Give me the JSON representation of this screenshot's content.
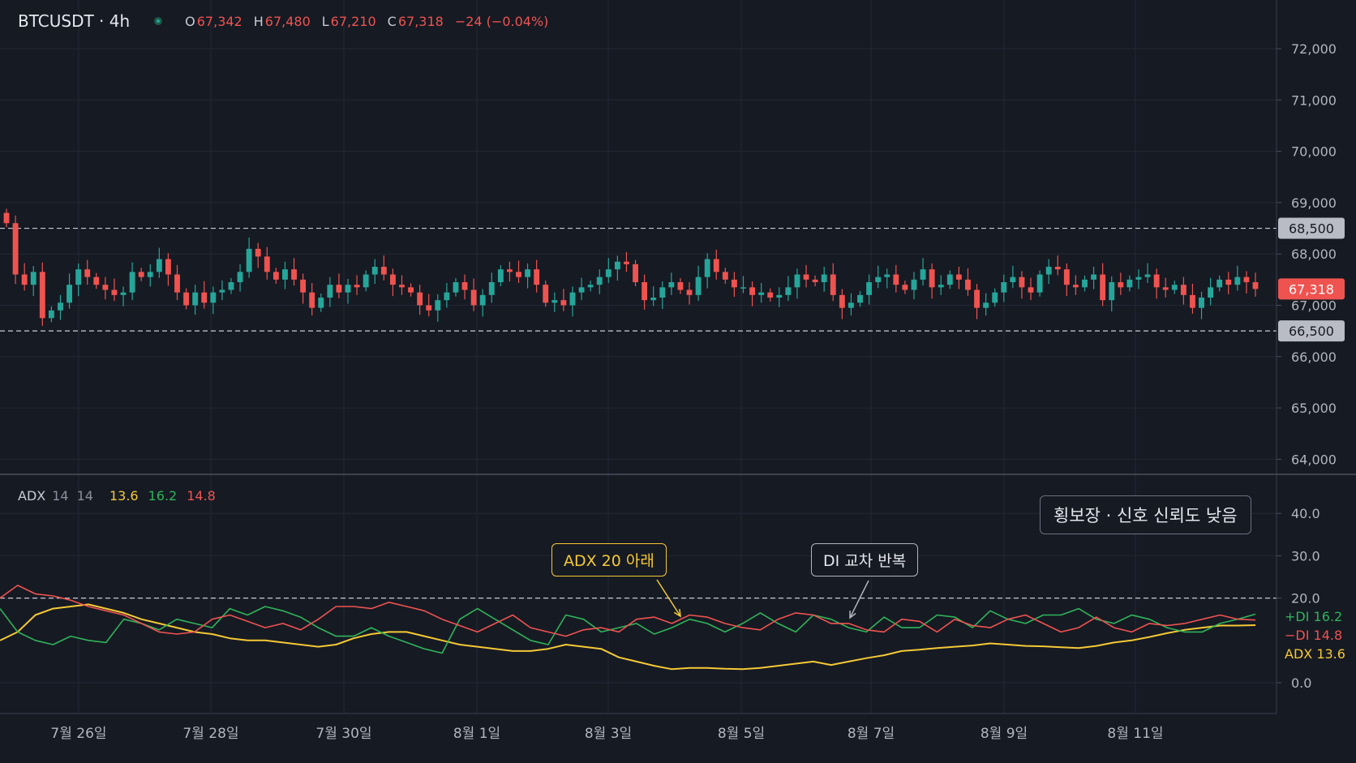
{
  "header": {
    "symbol": "BTCUSDT · 4h",
    "open_key": "O",
    "open": "67,342",
    "high_key": "H",
    "high": "67,480",
    "low_key": "L",
    "low": "67,210",
    "close_key": "C",
    "close": "67,318",
    "change": "−24 (−0.04%)"
  },
  "indicator": {
    "name": "ADX",
    "param1": "14",
    "param2": "14",
    "adx": "13.6",
    "plus_di": "16.2",
    "minus_di": "14.8"
  },
  "annotations": {
    "adx_note": "ADX 20 아래",
    "di_note": "DI 교차 반복",
    "regime_note": "횡보장 · 신호 신뢰도 낮음"
  },
  "price_axis": {
    "ticks": [
      "72,000",
      "71,000",
      "70,000",
      "69,000",
      "68,000",
      "67,000",
      "66,000",
      "65,000",
      "64,000"
    ],
    "resistance_label": "68,500",
    "support_label": "66,500",
    "last_label": "67,318"
  },
  "indicator_axis": {
    "ticks": [
      "40.0",
      "30.0",
      "20.0",
      "0.0"
    ],
    "plus_di_label": "+DI 16.2",
    "minus_di_label": "−DI 14.8",
    "adx_label": "ADX 13.6"
  },
  "time_axis": {
    "ticks": [
      "7월 26일",
      "7월 28일",
      "7월 30일",
      "8월 1일",
      "8월 3일",
      "8월 5일",
      "8월 7일",
      "8월 9일",
      "8월 11일"
    ]
  },
  "colors": {
    "background": "#161a23",
    "up": "#26a69a",
    "down": "#ef5350",
    "adx": "#f5c935",
    "plus_di": "#2fb45a",
    "minus_di": "#ef5350",
    "grid": "#232835",
    "label_gray": "#b2b5be"
  },
  "chart_data": [
    {
      "type": "candlestick",
      "title": "BTCUSDT · 4h",
      "timeframe": "4h",
      "x_ticks": [
        "7월 26일",
        "7월 28일",
        "7월 30일",
        "8월 1일",
        "8월 3일",
        "8월 5일",
        "8월 7일",
        "8월 9일",
        "8월 11일"
      ],
      "ylim": [
        63800,
        72600
      ],
      "y_ticks": [
        72000,
        71000,
        70000,
        69000,
        68000,
        67000,
        66000,
        65000,
        64000
      ],
      "last": {
        "open": 67342,
        "high": 67480,
        "low": 67210,
        "close": 67318,
        "change": -24,
        "change_pct": -0.04
      },
      "horizontal_levels": [
        {
          "value": 68500,
          "style": "dashed"
        },
        {
          "value": 66500,
          "style": "dashed"
        }
      ],
      "closes": [
        68600,
        67600,
        67400,
        67650,
        66750,
        66900,
        67050,
        67400,
        67700,
        67550,
        67400,
        67300,
        67200,
        67250,
        67650,
        67550,
        67650,
        67900,
        67600,
        67250,
        67000,
        67250,
        67050,
        67250,
        67300,
        67450,
        67650,
        68100,
        67950,
        67650,
        67500,
        67700,
        67500,
        67250,
        66950,
        67150,
        67400,
        67250,
        67400,
        67350,
        67600,
        67750,
        67600,
        67400,
        67350,
        67250,
        67000,
        66900,
        67100,
        67250,
        67450,
        67300,
        67000,
        67200,
        67450,
        67700,
        67650,
        67550,
        67700,
        67400,
        67050,
        67100,
        67000,
        67250,
        67350,
        67400,
        67550,
        67700,
        67850,
        67800,
        67450,
        67100,
        67150,
        67350,
        67450,
        67300,
        67200,
        67550,
        67900,
        67650,
        67500,
        67350,
        67350,
        67200,
        67250,
        67150,
        67200,
        67350,
        67600,
        67500,
        67450,
        67600,
        67200,
        66950,
        67050,
        67200,
        67450,
        67550,
        67600,
        67400,
        67300,
        67500,
        67700,
        67350,
        67400,
        67600,
        67500,
        67300,
        66950,
        67050,
        67250,
        67450,
        67550,
        67350,
        67250,
        67600,
        67750,
        67700,
        67400,
        67350,
        67500,
        67600,
        67100,
        67450,
        67350,
        67500,
        67550,
        67600,
        67350,
        67300,
        67400,
        67200,
        66950,
        67150,
        67350,
        67500,
        67400,
        67550,
        67450,
        67318
      ],
      "series": [
        {
          "name": "BTCUSDT"
        }
      ]
    },
    {
      "type": "line",
      "title": "ADX 14 14",
      "ylim": [
        -7,
        48
      ],
      "y_ticks": [
        40.0,
        30.0,
        20.0,
        0.0
      ],
      "reference_line": 20,
      "series": [
        {
          "name": "ADX",
          "color": "#f5c935",
          "values": [
            10,
            12,
            16,
            17.5,
            18,
            18.5,
            17.5,
            16.5,
            15,
            14,
            13,
            12,
            11.5,
            10.5,
            10,
            10,
            9.5,
            9,
            8.5,
            9,
            10.5,
            11.5,
            12,
            12,
            11,
            10,
            9,
            8.5,
            8,
            7.5,
            7.5,
            8,
            9,
            8.5,
            8,
            6,
            5,
            4,
            3.2,
            3.5,
            3.5,
            3.3,
            3.2,
            3.5,
            4,
            4.5,
            5,
            4.2,
            5,
            5.8,
            6.5,
            7.5,
            7.8,
            8.2,
            8.5,
            8.8,
            9.3,
            9,
            8.7,
            8.6,
            8.4,
            8.2,
            8.7,
            9.5,
            10,
            10.8,
            11.7,
            12.5,
            13,
            13.5,
            13.5,
            13.6
          ]
        },
        {
          "name": "+DI",
          "color": "#2fb45a",
          "values": [
            17.5,
            12,
            10,
            9,
            11,
            10,
            9.5,
            15,
            14,
            12.5,
            15,
            14,
            13,
            17.5,
            16,
            18,
            17,
            15.5,
            13,
            11,
            11,
            13,
            11,
            9.5,
            8,
            7,
            15,
            17.5,
            15,
            12.5,
            10,
            9,
            16,
            15,
            12,
            13,
            14,
            11.5,
            13,
            15,
            14,
            12,
            14,
            16.5,
            14,
            12,
            16,
            15,
            13,
            12,
            15.5,
            13,
            13,
            16,
            15.5,
            13,
            17,
            15,
            14,
            16,
            16,
            17.5,
            15,
            14,
            16,
            15,
            13,
            12,
            12,
            14,
            15,
            16.2
          ]
        },
        {
          "name": "−DI",
          "color": "#ef5350",
          "values": [
            20,
            23,
            21,
            20.5,
            19.5,
            18,
            17,
            16,
            14,
            12,
            11.5,
            12,
            15,
            16,
            14.5,
            13,
            14,
            12.5,
            15,
            18,
            18,
            17.5,
            19,
            18,
            17,
            15,
            13.5,
            12,
            14,
            16,
            13,
            12,
            11,
            12.5,
            13,
            12,
            15,
            15.5,
            14,
            16,
            15.5,
            14,
            13,
            12.5,
            15,
            16.5,
            16,
            14,
            14,
            12.5,
            12,
            15,
            14.5,
            12,
            15,
            13.5,
            13,
            15,
            16,
            14,
            12,
            13,
            15.5,
            13,
            12,
            14,
            13.5,
            14,
            15,
            16,
            15,
            14.8
          ]
        }
      ]
    }
  ]
}
